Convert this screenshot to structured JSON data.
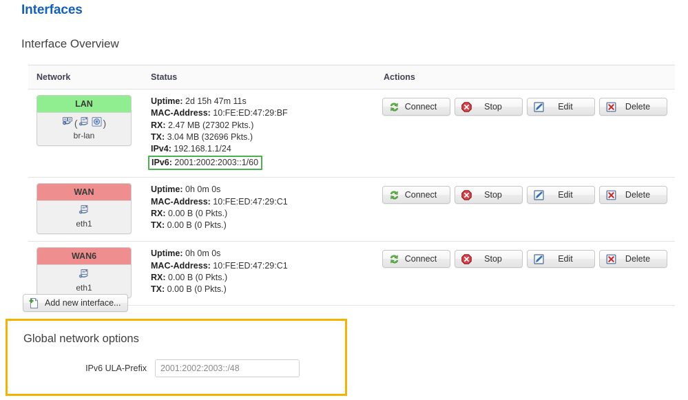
{
  "page": {
    "title": "Interfaces",
    "section_title": "Interface Overview"
  },
  "table": {
    "headers": {
      "network": "Network",
      "status": "Status",
      "actions": "Actions"
    },
    "rows": [
      {
        "name": "LAN",
        "state": "up",
        "device": "br-lan",
        "icons": [
          "ethernet-icon",
          "ethernet-icon",
          "wireless-icon"
        ],
        "status": {
          "uptime_label": "Uptime:",
          "uptime_value": "2d 15h 47m 11s",
          "mac_label": "MAC-Address:",
          "mac_value": "10:FE:ED:47:29:BF",
          "rx_label": "RX:",
          "rx_value": "2.47 MB (27302 Pkts.)",
          "tx_label": "TX:",
          "tx_value": "3.04 MB (32696 Pkts.)",
          "ipv4_label": "IPv4:",
          "ipv4_value": "192.168.1.1/24",
          "ipv6_label": "IPv6:",
          "ipv6_value": "2001:2002:2003::1/60",
          "ipv6_highlighted": true
        },
        "actions": [
          "Connect",
          "Stop",
          "Edit",
          "Delete"
        ]
      },
      {
        "name": "WAN",
        "state": "down",
        "device": "eth1",
        "icons": [
          "ethernet-icon"
        ],
        "status": {
          "uptime_label": "Uptime:",
          "uptime_value": "0h 0m 0s",
          "mac_label": "MAC-Address:",
          "mac_value": "10:FE:ED:47:29:C1",
          "rx_label": "RX:",
          "rx_value": "0.00 B (0 Pkts.)",
          "tx_label": "TX:",
          "tx_value": "0.00 B (0 Pkts.)",
          "ipv4_label": "",
          "ipv4_value": "",
          "ipv6_label": "",
          "ipv6_value": "",
          "ipv6_highlighted": false
        },
        "actions": [
          "Connect",
          "Stop",
          "Edit",
          "Delete"
        ]
      },
      {
        "name": "WAN6",
        "state": "down",
        "device": "eth1",
        "icons": [
          "ethernet-icon"
        ],
        "status": {
          "uptime_label": "Uptime:",
          "uptime_value": "0h 0m 0s",
          "mac_label": "MAC-Address:",
          "mac_value": "10:FE:ED:47:29:C1",
          "rx_label": "RX:",
          "rx_value": "0.00 B (0 Pkts.)",
          "tx_label": "TX:",
          "tx_value": "0.00 B (0 Pkts.)",
          "ipv4_label": "",
          "ipv4_value": "",
          "ipv6_label": "",
          "ipv6_value": "",
          "ipv6_highlighted": false
        },
        "actions": [
          "Connect",
          "Stop",
          "Edit",
          "Delete"
        ]
      }
    ],
    "action_icons": [
      "connect-refresh-icon",
      "stop-icon",
      "edit-pencil-icon",
      "delete-x-icon"
    ]
  },
  "add_interface": {
    "label": "Add new interface...",
    "icon": "new-page-icon"
  },
  "global_options": {
    "title": "Global network options",
    "ula_label": "IPv6 ULA-Prefix",
    "ula_value": "2001:2002:2003::/48"
  },
  "colors": {
    "title_blue": "#1560bd",
    "state_up_green": "#90ee90",
    "state_down_red": "#ef8e8e",
    "highlight_green": "#4caf50",
    "highlight_yellow": "#f5b301"
  }
}
